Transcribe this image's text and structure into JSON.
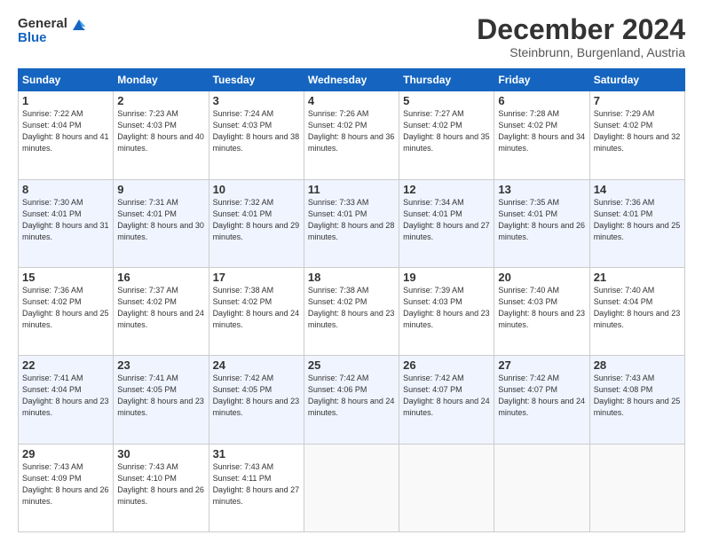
{
  "logo": {
    "general": "General",
    "blue": "Blue"
  },
  "header": {
    "month": "December 2024",
    "location": "Steinbrunn, Burgenland, Austria"
  },
  "days_of_week": [
    "Sunday",
    "Monday",
    "Tuesday",
    "Wednesday",
    "Thursday",
    "Friday",
    "Saturday"
  ],
  "weeks": [
    [
      {
        "day": "1",
        "sunrise": "7:22 AM",
        "sunset": "4:04 PM",
        "daylight": "8 hours and 41 minutes."
      },
      {
        "day": "2",
        "sunrise": "7:23 AM",
        "sunset": "4:03 PM",
        "daylight": "8 hours and 40 minutes."
      },
      {
        "day": "3",
        "sunrise": "7:24 AM",
        "sunset": "4:03 PM",
        "daylight": "8 hours and 38 minutes."
      },
      {
        "day": "4",
        "sunrise": "7:26 AM",
        "sunset": "4:02 PM",
        "daylight": "8 hours and 36 minutes."
      },
      {
        "day": "5",
        "sunrise": "7:27 AM",
        "sunset": "4:02 PM",
        "daylight": "8 hours and 35 minutes."
      },
      {
        "day": "6",
        "sunrise": "7:28 AM",
        "sunset": "4:02 PM",
        "daylight": "8 hours and 34 minutes."
      },
      {
        "day": "7",
        "sunrise": "7:29 AM",
        "sunset": "4:02 PM",
        "daylight": "8 hours and 32 minutes."
      }
    ],
    [
      {
        "day": "8",
        "sunrise": "7:30 AM",
        "sunset": "4:01 PM",
        "daylight": "8 hours and 31 minutes."
      },
      {
        "day": "9",
        "sunrise": "7:31 AM",
        "sunset": "4:01 PM",
        "daylight": "8 hours and 30 minutes."
      },
      {
        "day": "10",
        "sunrise": "7:32 AM",
        "sunset": "4:01 PM",
        "daylight": "8 hours and 29 minutes."
      },
      {
        "day": "11",
        "sunrise": "7:33 AM",
        "sunset": "4:01 PM",
        "daylight": "8 hours and 28 minutes."
      },
      {
        "day": "12",
        "sunrise": "7:34 AM",
        "sunset": "4:01 PM",
        "daylight": "8 hours and 27 minutes."
      },
      {
        "day": "13",
        "sunrise": "7:35 AM",
        "sunset": "4:01 PM",
        "daylight": "8 hours and 26 minutes."
      },
      {
        "day": "14",
        "sunrise": "7:36 AM",
        "sunset": "4:01 PM",
        "daylight": "8 hours and 25 minutes."
      }
    ],
    [
      {
        "day": "15",
        "sunrise": "7:36 AM",
        "sunset": "4:02 PM",
        "daylight": "8 hours and 25 minutes."
      },
      {
        "day": "16",
        "sunrise": "7:37 AM",
        "sunset": "4:02 PM",
        "daylight": "8 hours and 24 minutes."
      },
      {
        "day": "17",
        "sunrise": "7:38 AM",
        "sunset": "4:02 PM",
        "daylight": "8 hours and 24 minutes."
      },
      {
        "day": "18",
        "sunrise": "7:38 AM",
        "sunset": "4:02 PM",
        "daylight": "8 hours and 23 minutes."
      },
      {
        "day": "19",
        "sunrise": "7:39 AM",
        "sunset": "4:03 PM",
        "daylight": "8 hours and 23 minutes."
      },
      {
        "day": "20",
        "sunrise": "7:40 AM",
        "sunset": "4:03 PM",
        "daylight": "8 hours and 23 minutes."
      },
      {
        "day": "21",
        "sunrise": "7:40 AM",
        "sunset": "4:04 PM",
        "daylight": "8 hours and 23 minutes."
      }
    ],
    [
      {
        "day": "22",
        "sunrise": "7:41 AM",
        "sunset": "4:04 PM",
        "daylight": "8 hours and 23 minutes."
      },
      {
        "day": "23",
        "sunrise": "7:41 AM",
        "sunset": "4:05 PM",
        "daylight": "8 hours and 23 minutes."
      },
      {
        "day": "24",
        "sunrise": "7:42 AM",
        "sunset": "4:05 PM",
        "daylight": "8 hours and 23 minutes."
      },
      {
        "day": "25",
        "sunrise": "7:42 AM",
        "sunset": "4:06 PM",
        "daylight": "8 hours and 24 minutes."
      },
      {
        "day": "26",
        "sunrise": "7:42 AM",
        "sunset": "4:07 PM",
        "daylight": "8 hours and 24 minutes."
      },
      {
        "day": "27",
        "sunrise": "7:42 AM",
        "sunset": "4:07 PM",
        "daylight": "8 hours and 24 minutes."
      },
      {
        "day": "28",
        "sunrise": "7:43 AM",
        "sunset": "4:08 PM",
        "daylight": "8 hours and 25 minutes."
      }
    ],
    [
      {
        "day": "29",
        "sunrise": "7:43 AM",
        "sunset": "4:09 PM",
        "daylight": "8 hours and 26 minutes."
      },
      {
        "day": "30",
        "sunrise": "7:43 AM",
        "sunset": "4:10 PM",
        "daylight": "8 hours and 26 minutes."
      },
      {
        "day": "31",
        "sunrise": "7:43 AM",
        "sunset": "4:11 PM",
        "daylight": "8 hours and 27 minutes."
      },
      null,
      null,
      null,
      null
    ]
  ]
}
